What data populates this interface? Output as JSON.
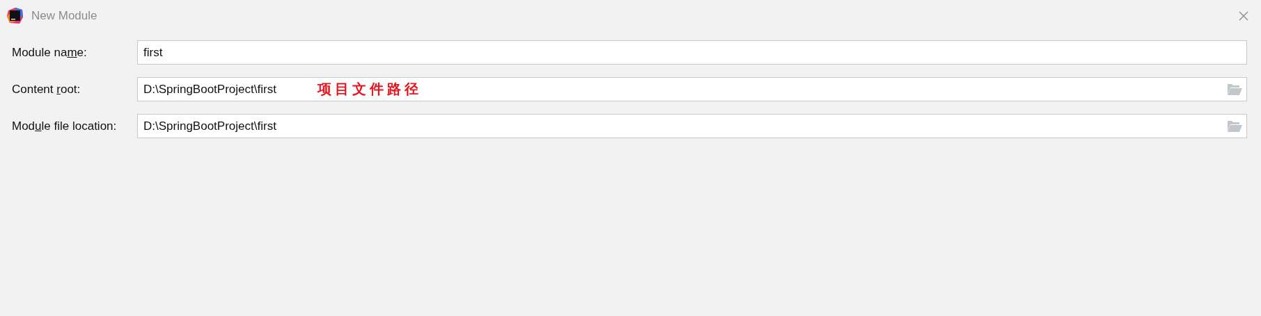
{
  "window": {
    "title": "New Module"
  },
  "fields": [
    {
      "kind": "text",
      "label": {
        "before": "Module na",
        "key": "m",
        "after": "e:"
      },
      "value": "first"
    },
    {
      "kind": "path",
      "label": {
        "before": "Content ",
        "key": "r",
        "after": "oot:"
      },
      "value": "D:\\SpringBootProject\\first",
      "annotation": "项目文件路径"
    },
    {
      "kind": "path",
      "label": {
        "before": "Mod",
        "key": "u",
        "after": "le file location:"
      },
      "value": "D:\\SpringBootProject\\first"
    }
  ]
}
